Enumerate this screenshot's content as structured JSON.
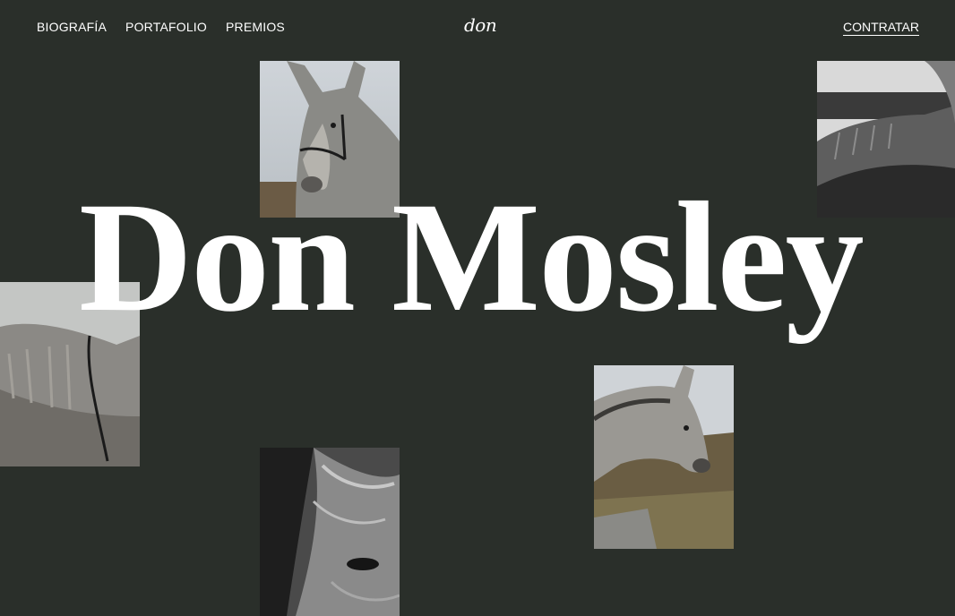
{
  "nav": {
    "links": [
      {
        "label": "BIOGRAFÍA"
      },
      {
        "label": "PORTAFOLIO"
      },
      {
        "label": "PREMIOS"
      }
    ],
    "logo": "don",
    "cta_label": "CONTRATAR"
  },
  "hero": {
    "title": "Don Mosley"
  },
  "colors": {
    "background": "#2a2f2a",
    "text": "#ffffff"
  },
  "photos": [
    {
      "name": "photo-donkey-portrait-halter"
    },
    {
      "name": "photo-donkey-back-bw"
    },
    {
      "name": "photo-donkey-body-halter"
    },
    {
      "name": "photo-donkey-profile-field"
    },
    {
      "name": "photo-donkey-closeup-bw"
    }
  ]
}
